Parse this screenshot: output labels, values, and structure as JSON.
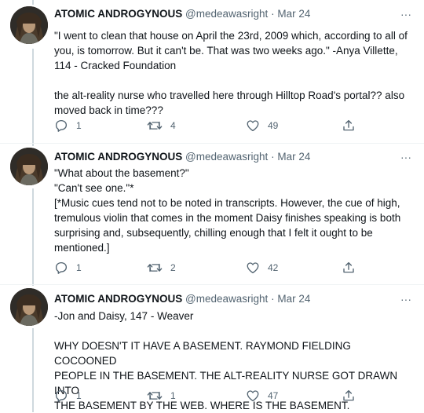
{
  "tweets": [
    {
      "name": "ATOMIC ANDROGYNOUS",
      "handle": "@medeawasright",
      "sep": "·",
      "date": "Mar 24",
      "more": "···",
      "lines": [
        "\"I went to clean that house on April the 23rd, 2009 which, according to all of",
        "you, is tomorrow. But it can't be. That was two weeks ago.\" -Anya Villette,",
        "114 - Cracked Foundation",
        "",
        "the alt-reality nurse who travelled here through Hilltop Road's portal?? also",
        "moved back in time???"
      ],
      "replies": "1",
      "retweets": "4",
      "likes": "49"
    },
    {
      "name": "ATOMIC ANDROGYNOUS",
      "handle": "@medeawasright",
      "sep": "·",
      "date": "Mar 24",
      "more": "···",
      "lines": [
        "\"What about the basement?\"",
        "\"Can't see one.\"*",
        "[*Music cues tend not to be noted in transcripts. However, the cue of high,",
        "tremulous violin that comes in the moment Daisy finishes speaking is both",
        "surprising and, subsequently, chilling enough that I felt it ought to be",
        "mentioned.]"
      ],
      "replies": "1",
      "retweets": "2",
      "likes": "42"
    },
    {
      "name": "ATOMIC ANDROGYNOUS",
      "handle": "@medeawasright",
      "sep": "·",
      "date": "Mar 24",
      "more": "···",
      "lines": [
        "-Jon and Daisy, 147 - Weaver",
        "",
        "WHY DOESN'T IT HAVE A BASEMENT. RAYMOND FIELDING COCOONED",
        "PEOPLE IN THE BASEMENT. THE ALT-REALITY NURSE GOT DRAWN INTO",
        "THE BASEMENT BY THE WEB. WHERE IS THE BASEMENT."
      ],
      "replies": "1",
      "retweets": "1",
      "likes": "47"
    }
  ],
  "icons": {
    "reply": "reply-icon",
    "retweet": "retweet-icon",
    "like": "like-icon",
    "share": "share-icon",
    "more": "more-icon"
  },
  "colors": {
    "text": "#0f1419",
    "secondary": "#536471",
    "thread_line": "#cfd9de",
    "divider": "#eff3f4"
  }
}
